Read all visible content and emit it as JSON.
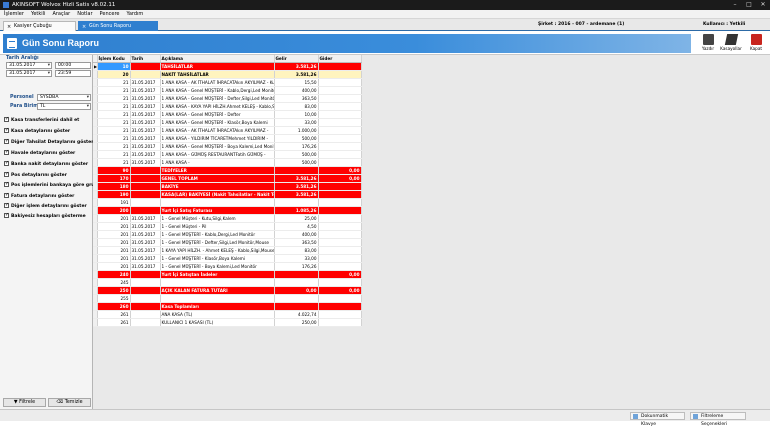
{
  "window": {
    "title": "AKINSOFT Wolvox Hizli Satis v8.02.11"
  },
  "menu": [
    "İşlemler",
    "Yetkili",
    "Araçlar",
    "Notlar",
    "Pencere",
    "Yardım"
  ],
  "tabs": [
    {
      "label": "Kasiyer Çubuğu"
    },
    {
      "label": "Gün Sonu Raporu"
    }
  ],
  "info": {
    "sirket": "Şirket : 2016 - 007 - ardemane (1)",
    "kullanici": "Kullanıcı : Yetkili"
  },
  "header": {
    "title": "Gün Sonu Raporu"
  },
  "toolbar": {
    "print": "Yazdır",
    "calc": "Kasayollar",
    "close": "Kapat"
  },
  "filters": {
    "date_label": "Tarih Aralığı",
    "date_from": "31.05.2017",
    "time_from": "00:00",
    "date_to": "31.05.2017",
    "time_to": "23:59",
    "personel_label": "Personel",
    "personel_value": "SYSDBA",
    "para_label": "Para Birimi",
    "para_value": "TL"
  },
  "options": [
    "Kasa transferlerini dahil et",
    "Kasa detaylarını göster",
    "Diğer Tahsilat Detaylarını göster",
    "Havale detaylarını göster",
    "Banka nakit detaylarını göster",
    "Pos detaylarını göster",
    "Pos işlemlerini bankaya göre grupla",
    "Fatura detaylarını göster",
    "Diğer işlem detaylarını göster",
    "Bakiyesiz hesapları gösterme"
  ],
  "buttons": {
    "filter": "Filtrele",
    "clear": "Temizle"
  },
  "columns": [
    "İşlem Kodu",
    "Tarih",
    "Açıklama",
    "Gelir",
    "Gider"
  ],
  "rows": [
    {
      "s": "red",
      "code": "10",
      "date": "",
      "desc": "TAHSİLATLAR",
      "gelir": "3.581,26",
      "gider": ""
    },
    {
      "s": "yellow",
      "code": "20",
      "date": "",
      "desc": "NAKİT TAHSİLATLAR",
      "gelir": "3.581,26",
      "gider": ""
    },
    {
      "s": "",
      "code": "21",
      "date": "31.05.2017",
      "desc": "1 ANA KASA - AK İTHALAT İHRACATAkın AKYILMAZ - Kutu,S",
      "gelir": "15,50",
      "gider": ""
    },
    {
      "s": "",
      "code": "21",
      "date": "31.05.2017",
      "desc": "1 ANA KASA - Genel MÜŞTERİ - Kablo,Dergi,Led Monitör",
      "gelir": "400,00",
      "gider": ""
    },
    {
      "s": "",
      "code": "21",
      "date": "31.05.2017",
      "desc": "1 ANA KASA - Genel MÜŞTERİ - Defter,Silgi,Led Monitör,Mou",
      "gelir": "363,50",
      "gider": ""
    },
    {
      "s": "",
      "code": "21",
      "date": "31.05.2017",
      "desc": "1 ANA KASA - KAYA YAPI HİLZH.Ahmet KELEŞ - Kablo,Silgi,H",
      "gelir": "83,00",
      "gider": ""
    },
    {
      "s": "",
      "code": "21",
      "date": "31.05.2017",
      "desc": "1 ANA KASA - Genel MÜŞTERİ - Defter",
      "gelir": "10,00",
      "gider": ""
    },
    {
      "s": "",
      "code": "21",
      "date": "31.05.2017",
      "desc": "1 ANA KASA - Genel MÜŞTERİ - Klasör,Boya Kalemi",
      "gelir": "33,00",
      "gider": ""
    },
    {
      "s": "",
      "code": "21",
      "date": "31.05.2017",
      "desc": "1 ANA KASA - AK İTHALAT İHRACATAkın AKYILMAZ -",
      "gelir": "1.000,00",
      "gider": ""
    },
    {
      "s": "",
      "code": "21",
      "date": "31.05.2017",
      "desc": "1 ANA KASA - YILDIRIM TİCARETMehmet YILDIRIM -",
      "gelir": "500,00",
      "gider": ""
    },
    {
      "s": "",
      "code": "21",
      "date": "31.05.2017",
      "desc": "1 ANA KASA - Genel MÜŞTERİ - Boya Kalemi,Led Monitör",
      "gelir": "176,26",
      "gider": ""
    },
    {
      "s": "",
      "code": "21",
      "date": "31.05.2017",
      "desc": "1 ANA KASA - GÜMÜŞ RESTAURANTFatih GÜMÜŞ -",
      "gelir": "500,00",
      "gider": ""
    },
    {
      "s": "",
      "code": "21",
      "date": "31.05.2017",
      "desc": "1 ANA KASA -",
      "gelir": "500,00",
      "gider": ""
    },
    {
      "s": "red",
      "code": "90",
      "date": "",
      "desc": "TEDİYELER",
      "gelir": "",
      "gider": "0,00"
    },
    {
      "s": "red",
      "code": "170",
      "date": "",
      "desc": "GENEL TOPLAM",
      "gelir": "3.581,26",
      "gider": "0,00"
    },
    {
      "s": "red",
      "code": "180",
      "date": "",
      "desc": "BAKİYE",
      "gelir": "3.581,26",
      "gider": ""
    },
    {
      "s": "red",
      "code": "190",
      "date": "",
      "desc": "KASA(LAR) BAKİYESİ (Nakit Tahsilatlar - Nakit Tediyeler)",
      "gelir": "3.581,26",
      "gider": ""
    },
    {
      "s": "",
      "code": "191",
      "date": "",
      "desc": "",
      "gelir": "",
      "gider": ""
    },
    {
      "s": "red",
      "code": "200",
      "date": "",
      "desc": "Yurt İçi Satış Faturası",
      "gelir": "1.085,26",
      "gider": ""
    },
    {
      "s": "",
      "code": "201",
      "date": "31.05.2017",
      "desc": "1 - Genel Müşteri - Kutu,Silgi,Kalem",
      "gelir": "25,00",
      "gider": ""
    },
    {
      "s": "",
      "code": "201",
      "date": "31.05.2017",
      "desc": "1 - Genel Müşteri - Pil",
      "gelir": "4,50",
      "gider": ""
    },
    {
      "s": "",
      "code": "201",
      "date": "31.05.2017",
      "desc": "1 - Genel MÜŞTERİ - Kablo,Dergi,Led Monitör",
      "gelir": "400,00",
      "gider": ""
    },
    {
      "s": "",
      "code": "201",
      "date": "31.05.2017",
      "desc": "1 - Genel MÜŞTERİ - Defter,Silgi,Led Monitör,Mouse",
      "gelir": "363,50",
      "gider": ""
    },
    {
      "s": "",
      "code": "201",
      "date": "31.05.2017",
      "desc": "1 KAYA YAPI HİLZH. - Ahmet KELEŞ - Kablo,Silgi,Mouse,Boya",
      "gelir": "83,00",
      "gider": ""
    },
    {
      "s": "",
      "code": "201",
      "date": "31.05.2017",
      "desc": "1 - Genel MÜŞTERİ - Klasör,Boya Kalemi",
      "gelir": "33,00",
      "gider": ""
    },
    {
      "s": "",
      "code": "201",
      "date": "31.05.2017",
      "desc": "1 - Genel MÜŞTERİ - Boya Kalemi,Led Monitör",
      "gelir": "176,26",
      "gider": ""
    },
    {
      "s": "red",
      "code": "240",
      "date": "",
      "desc": "Yurt İçi Satıştan İadeler",
      "gelir": "",
      "gider": "0,00"
    },
    {
      "s": "",
      "code": "245",
      "date": "",
      "desc": "",
      "gelir": "",
      "gider": ""
    },
    {
      "s": "red",
      "code": "250",
      "date": "",
      "desc": "AÇIK KALAN FATURA TUTARI",
      "gelir": "0,00",
      "gider": "0,00"
    },
    {
      "s": "",
      "code": "255",
      "date": "",
      "desc": "",
      "gelir": "",
      "gider": ""
    },
    {
      "s": "red",
      "code": "260",
      "date": "",
      "desc": "Kasa Toplamları",
      "gelir": "",
      "gider": ""
    },
    {
      "s": "",
      "code": "261",
      "date": "",
      "desc": "ANA KASA (TL)",
      "gelir": "4.022,74",
      "gider": ""
    },
    {
      "s": "",
      "code": "261",
      "date": "",
      "desc": "KULLANICI 1 KASASI (TL)",
      "gelir": "250,00",
      "gider": ""
    }
  ],
  "status": {
    "keyboard": "Dokunmatik Klavye",
    "settings": "Filtreleme Seçenekleri"
  },
  "colors": {
    "accent": "#2f7fcf",
    "highlight": "#ff0000",
    "yellow": "#fff4bf"
  }
}
